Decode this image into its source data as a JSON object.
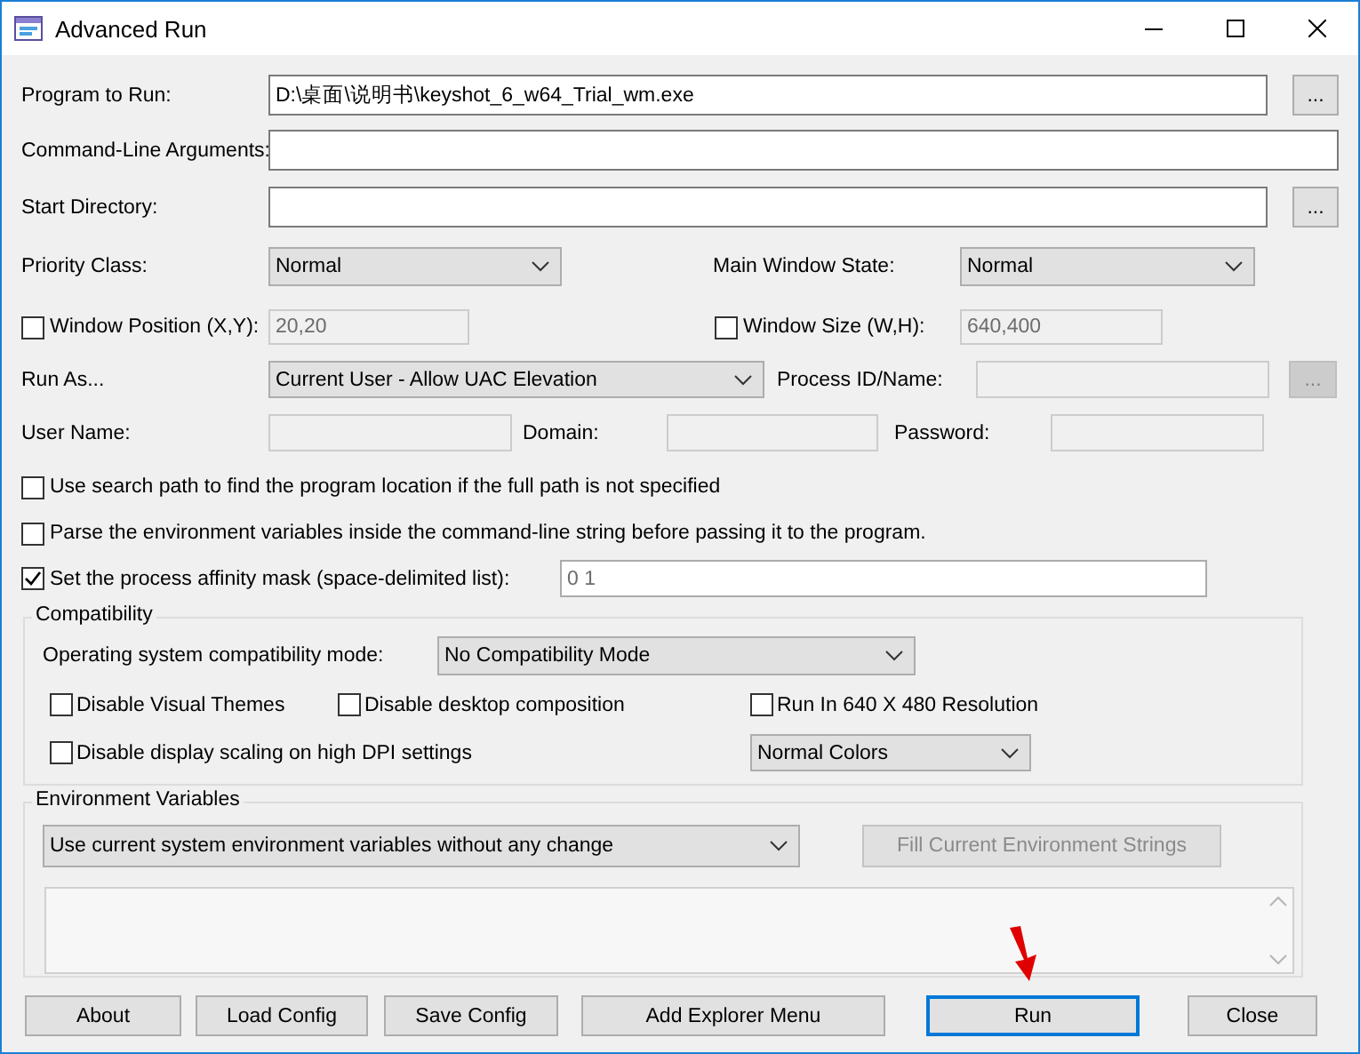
{
  "window": {
    "title": "Advanced Run"
  },
  "program": {
    "label": "Program to Run:",
    "value": "D:\\桌面\\说明书\\keyshot_6_w64_Trial_wm.exe",
    "button": "..."
  },
  "arguments": {
    "label": "Command-Line Arguments:"
  },
  "start_directory": {
    "label": "Start Directory:",
    "button": "..."
  },
  "priority_class": {
    "label": "Priority Class:",
    "value": "Normal"
  },
  "main_window_state": {
    "label": "Main Window State:",
    "value": "Normal"
  },
  "window_position": {
    "label": "Window Position (X,Y):",
    "checked": false,
    "value": "20,20",
    "disabled": true
  },
  "window_size": {
    "label": "Window Size (W,H):",
    "checked": false,
    "value": "640,400",
    "disabled": true
  },
  "run_as": {
    "label": "Run As...",
    "value": "Current User - Allow UAC Elevation"
  },
  "process_id": {
    "label": "Process ID/Name:",
    "disabled": true,
    "button": "..."
  },
  "user_name": {
    "label": "User Name:",
    "disabled": true
  },
  "domain": {
    "label": "Domain:",
    "disabled": true
  },
  "password": {
    "label": "Password:",
    "disabled": true
  },
  "options": [
    {
      "label": "Use search path to find the program location if the full path is not specified",
      "checked": false
    },
    {
      "label": "Parse the environment variables inside the command-line string before passing it to the program.",
      "checked": false
    },
    {
      "label": "Set the process affinity mask (space-delimited list):",
      "checked": true,
      "value": "0 1"
    }
  ],
  "compatibility": {
    "title": "Compatibility",
    "mode_label": "Operating system compatibility mode:",
    "mode": "No Compatibility Mode",
    "options": [
      {
        "label": "Disable Visual Themes",
        "checked": false
      },
      {
        "label": "Disable desktop composition",
        "checked": false
      },
      {
        "label": "Run In 640 X 480 Resolution",
        "checked": false
      },
      {
        "label": "Disable display scaling on high DPI settings",
        "checked": false
      }
    ],
    "colors": "Normal Colors"
  },
  "environment": {
    "title": "Environment Variables",
    "mode": "Use current system environment variables without any change",
    "fill_button": {
      "label": "Fill Current Environment Strings",
      "disabled": true
    }
  },
  "buttons": [
    {
      "label": "About",
      "default": false
    },
    {
      "label": "Load Config",
      "default": false
    },
    {
      "label": "Save Config",
      "default": false
    },
    {
      "label": "Add Explorer Menu",
      "default": false
    },
    {
      "label": "Run",
      "default": true
    },
    {
      "label": "Close",
      "default": false
    }
  ]
}
